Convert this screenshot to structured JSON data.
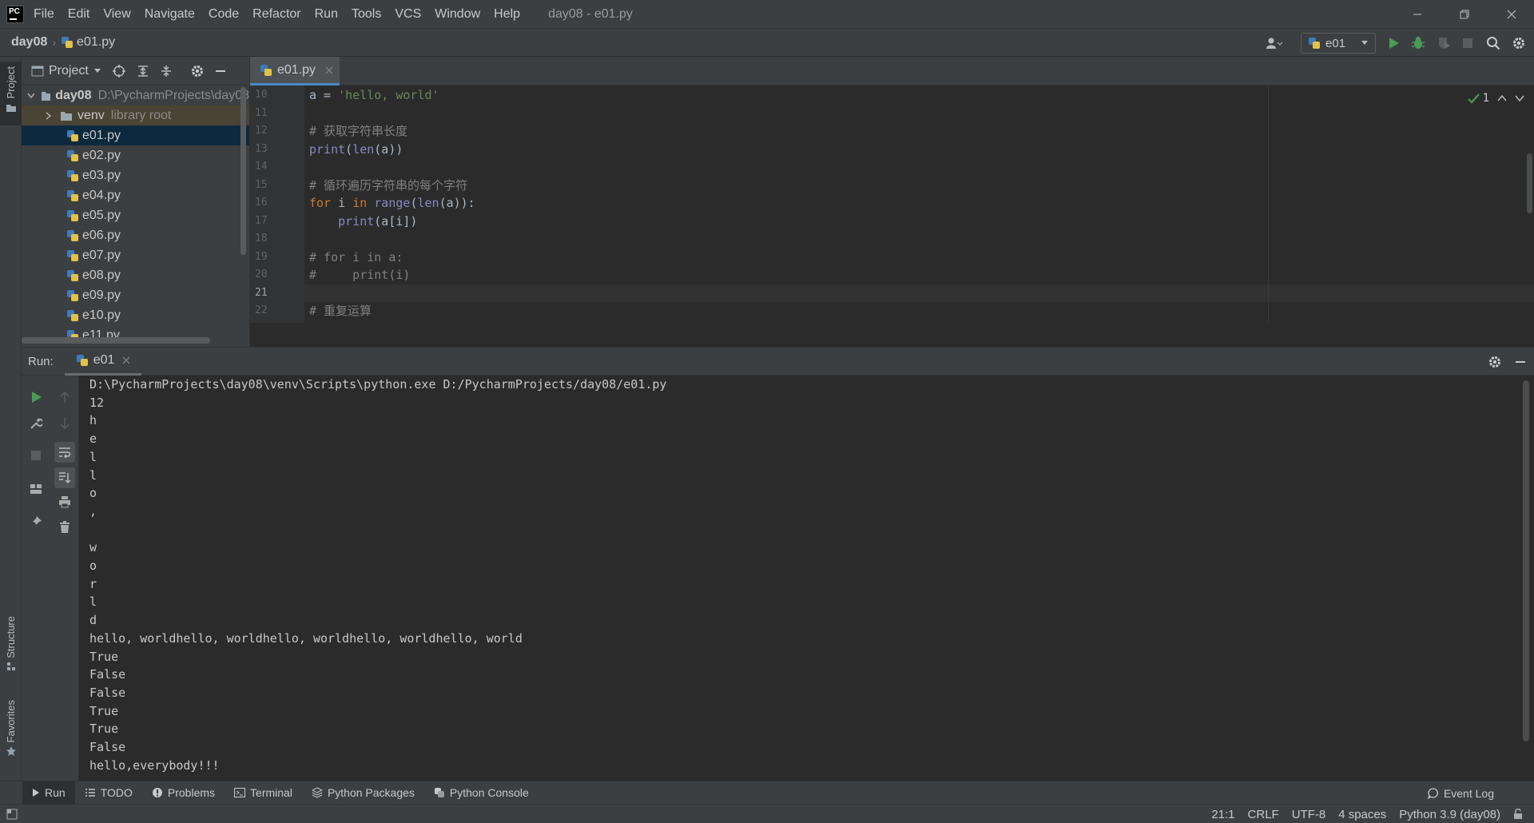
{
  "menubar": {
    "logo_text": "PC",
    "items": [
      "File",
      "Edit",
      "View",
      "Navigate",
      "Code",
      "Refactor",
      "Run",
      "Tools",
      "VCS",
      "Window",
      "Help"
    ],
    "window_title": "day08 - e01.py"
  },
  "navbar": {
    "project": "day08",
    "file": "e01.py",
    "run_config": "e01"
  },
  "project_panel": {
    "title": "Project",
    "root": {
      "name": "day08",
      "path": "D:\\PycharmProjects\\day08"
    },
    "venv": {
      "name": "venv",
      "hint": "library root"
    },
    "files": [
      "e01.py",
      "e02.py",
      "e03.py",
      "e04.py",
      "e05.py",
      "e06.py",
      "e07.py",
      "e08.py",
      "e09.py",
      "e10.py",
      "e11.py"
    ],
    "selected": "e01.py"
  },
  "left_stripe": {
    "project": "Project",
    "structure": "Structure",
    "favorites": "Favorites"
  },
  "editor": {
    "tab": "e01.py",
    "inspection_count": "1",
    "current_line": "21",
    "lines": [
      {
        "n": "10",
        "code": [
          {
            "t": "a = ",
            "c": ""
          },
          {
            "t": "'hello, world'",
            "c": "str"
          }
        ]
      },
      {
        "n": "11",
        "code": []
      },
      {
        "n": "12",
        "code": [
          {
            "t": "# 获取字符串长度",
            "c": "cm"
          }
        ]
      },
      {
        "n": "13",
        "code": [
          {
            "t": "print",
            "c": "fn"
          },
          {
            "t": "(",
            "c": ""
          },
          {
            "t": "len",
            "c": "fn"
          },
          {
            "t": "(a))",
            "c": ""
          }
        ]
      },
      {
        "n": "14",
        "code": []
      },
      {
        "n": "15",
        "code": [
          {
            "t": "# 循环遍历字符串的每个字符",
            "c": "cm"
          }
        ]
      },
      {
        "n": "16",
        "code": [
          {
            "t": "for",
            "c": "kw"
          },
          {
            "t": " i ",
            "c": ""
          },
          {
            "t": "in",
            "c": "kw"
          },
          {
            "t": " ",
            "c": ""
          },
          {
            "t": "range",
            "c": "fn"
          },
          {
            "t": "(",
            "c": ""
          },
          {
            "t": "len",
            "c": "fn"
          },
          {
            "t": "(a)):",
            "c": ""
          }
        ]
      },
      {
        "n": "17",
        "code": [
          {
            "t": "    ",
            "c": ""
          },
          {
            "t": "print",
            "c": "fn"
          },
          {
            "t": "(a[i])",
            "c": ""
          }
        ]
      },
      {
        "n": "18",
        "code": []
      },
      {
        "n": "19",
        "code": [
          {
            "t": "# for i in a:",
            "c": "cm"
          }
        ]
      },
      {
        "n": "20",
        "code": [
          {
            "t": "#     print(i)",
            "c": "cm"
          }
        ]
      },
      {
        "n": "21",
        "code": []
      },
      {
        "n": "22",
        "code": [
          {
            "t": "# 重复运算",
            "c": "cm"
          }
        ]
      }
    ]
  },
  "run_panel": {
    "label": "Run:",
    "tab": "e01",
    "output": [
      "D:\\PycharmProjects\\day08\\venv\\Scripts\\python.exe D:/PycharmProjects/day08/e01.py",
      "12",
      "h",
      "e",
      "l",
      "l",
      "o",
      ",",
      " ",
      "w",
      "o",
      "r",
      "l",
      "d",
      "hello, worldhello, worldhello, worldhello, worldhello, world",
      "True",
      "False",
      "False",
      "True",
      "True",
      "False",
      "hello,everybody!!!"
    ]
  },
  "bottom_bar": {
    "tabs": [
      "Run",
      "TODO",
      "Problems",
      "Terminal",
      "Python Packages",
      "Python Console"
    ],
    "event_log": "Event Log"
  },
  "status_bar": {
    "position": "21:1",
    "line_sep": "CRLF",
    "encoding": "UTF-8",
    "indent": "4 spaces",
    "interpreter": "Python 3.9 (day08)"
  },
  "colors": {
    "keyword": "#cc7832",
    "string": "#6a8759",
    "comment": "#808080",
    "builtin": "#8888c6",
    "run_green": "#499c54",
    "selection": "#0d293e"
  }
}
